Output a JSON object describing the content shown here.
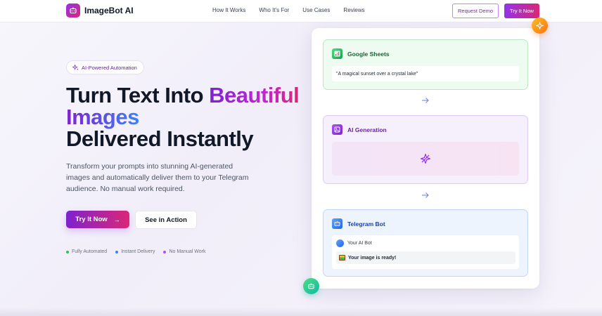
{
  "nav": {
    "brand": "ImageBot AI",
    "links": [
      "How It Works",
      "Who It's For",
      "Use Cases",
      "Reviews"
    ],
    "request_demo": "Request Demo",
    "try_now": "Try It Now"
  },
  "hero": {
    "badge": "AI-Powered Automation",
    "headline_part1": "Turn Text Into ",
    "headline_highlight1": "Beautiful",
    "headline_highlight2": "Images",
    "headline_part2": "Delivered Instantly",
    "description": "Transform your prompts into stunning AI-generated images and automatically deliver them to your Telegram audience. No manual work required.",
    "primary_cta": "Try It Now",
    "primary_cta_arrow": "→",
    "secondary_cta": "See in Action",
    "features": [
      {
        "label": "Fully Automated",
        "color": "#22c55e"
      },
      {
        "label": "Instant Delivery",
        "color": "#3b82f6"
      },
      {
        "label": "No Manual Work",
        "color": "#a855f7"
      }
    ]
  },
  "workflow": {
    "sheets": {
      "title": "Google Sheets",
      "prompt": "\"A magical sunset over a crystal lake\""
    },
    "generation": {
      "title": "AI Generation"
    },
    "telegram": {
      "title": "Telegram Bot",
      "bot_name": "Your AI Bot",
      "message": "Your image is ready!"
    }
  },
  "colors": {
    "accent_purple": "#9333ea",
    "accent_pink": "#db2777",
    "green": "#22c55e",
    "blue": "#3b82f6"
  }
}
